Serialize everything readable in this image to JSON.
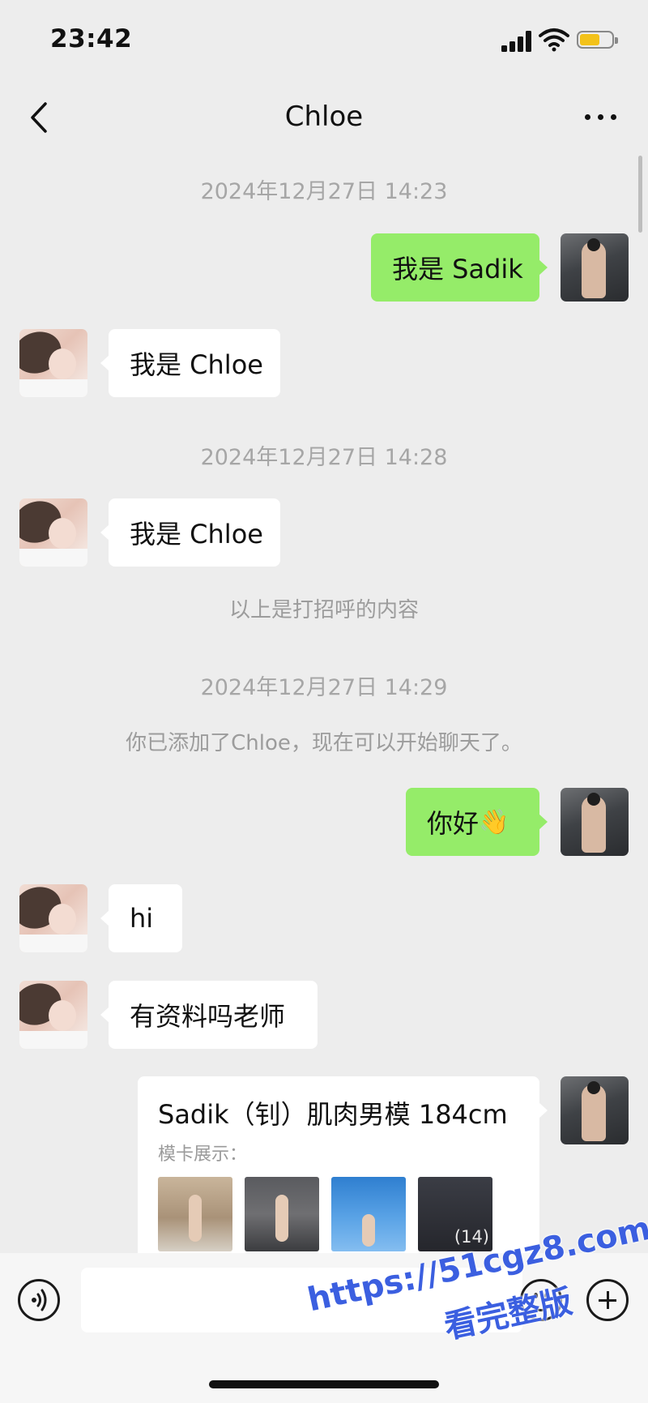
{
  "status_bar": {
    "time": "23:42",
    "battery_color": "#f3c21a"
  },
  "nav": {
    "title": "Chloe"
  },
  "chat": {
    "ts1": "2024年12月27日 14:23",
    "msg1": "我是 Sadik",
    "msg2": "我是 Chloe",
    "ts2": "2024年12月27日 14:28",
    "msg3": "我是 Chloe",
    "note1": "以上是打招呼的内容",
    "ts3": "2024年12月27日 14:29",
    "note2": "你已添加了Chloe，现在可以开始聊天了。",
    "msg4": "你好",
    "msg4_emoji": "👋",
    "msg5": "hi",
    "msg6": "有资料吗老师"
  },
  "card": {
    "title": "Sadik（钊）肌肉男模 184cm",
    "subtitle": "模卡展示：",
    "photo_count": "(14)"
  },
  "input": {
    "placeholder": ""
  },
  "watermark": {
    "line1": "https://51cgz8.com",
    "line2": "看完整版"
  },
  "colors": {
    "background": "#ededed",
    "outgoing_bubble": "#95ec69",
    "incoming_bubble": "#ffffff"
  }
}
